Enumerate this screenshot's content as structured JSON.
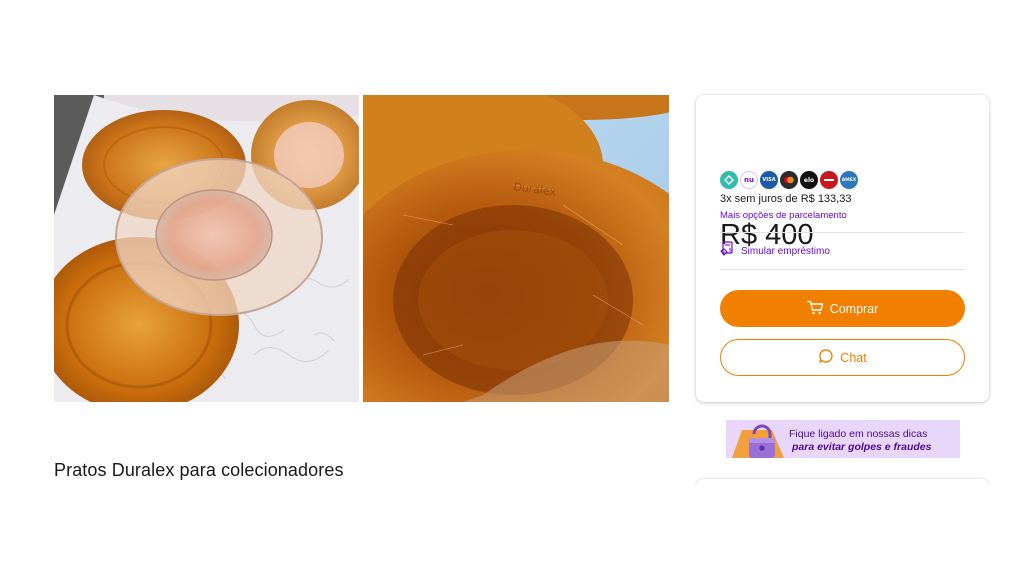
{
  "listing": {
    "title": "Pratos Duralex para colecionadores",
    "photos": [
      {
        "name": "photo-amber-plates-stacked"
      },
      {
        "name": "photo-amber-plate-closeup"
      }
    ]
  },
  "pricing": {
    "price": "R$ 400",
    "payment_icons": [
      {
        "name": "pix-icon",
        "label": "",
        "color": "#32bcad"
      },
      {
        "name": "nubank-icon",
        "label": "nu",
        "color": "#ffffff",
        "text_color": "#820ad1"
      },
      {
        "name": "visa-icon",
        "label": "VISA",
        "color": "#1a5aa8"
      },
      {
        "name": "mastercard-icon",
        "label": "",
        "color": "#2b2b2b"
      },
      {
        "name": "elo-icon",
        "label": "elo",
        "color": "#111111"
      },
      {
        "name": "hipercard-icon",
        "label": "",
        "color": "#c8161d"
      },
      {
        "name": "amex-icon",
        "label": "AMEX",
        "color": "#2e77bc"
      }
    ],
    "installments": "3x sem juros de R$ 133,33",
    "more_options": "Mais opções de parcelamento",
    "loan": "Simular empréstimo"
  },
  "actions": {
    "buy": "Comprar",
    "chat": "Chat"
  },
  "banner": {
    "line1": "Fique ligado em nossas dicas",
    "line2": "para evitar golpes e fraudes"
  },
  "colors": {
    "accent": "#f28000",
    "purple": "#6d0ad6",
    "banner_bg": "#e8d7fa"
  }
}
